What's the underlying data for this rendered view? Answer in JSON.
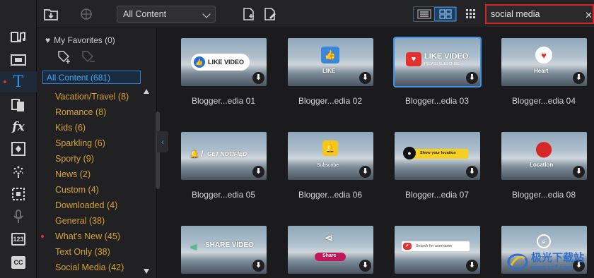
{
  "toolbar": {
    "filter_value": "All Content",
    "search_value": "social media"
  },
  "panel": {
    "favorites_label": "My Favorites (0)",
    "all_content_label": "All Content (681)",
    "categories": [
      {
        "label": "Vacation/Travel  (8)",
        "new": false
      },
      {
        "label": "Romance  (8)",
        "new": false
      },
      {
        "label": "Kids  (6)",
        "new": false
      },
      {
        "label": "Sparkling  (6)",
        "new": false
      },
      {
        "label": "Sporty  (9)",
        "new": false
      },
      {
        "label": "News  (2)",
        "new": false
      },
      {
        "label": "Custom  (4)",
        "new": false
      },
      {
        "label": "Downloaded  (4)",
        "new": false
      },
      {
        "label": "General  (38)",
        "new": false
      },
      {
        "label": "What's New  (45)",
        "new": true
      },
      {
        "label": "Text Only  (38)",
        "new": false
      },
      {
        "label": "Social Media  (42)",
        "new": false
      }
    ]
  },
  "grid": {
    "items": [
      {
        "caption": "Blogger...edia 01",
        "thumb_text": "LIKE VIDEO"
      },
      {
        "caption": "Blogger...edia 02",
        "thumb_text": "LIKE"
      },
      {
        "caption": "Blogger...edia 03",
        "thumb_text": "LIKE VIDEO",
        "thumb_sub": "PLEASE SUBSCRIBE",
        "selected": true
      },
      {
        "caption": "Blogger...edia 04",
        "thumb_text": "Heart"
      },
      {
        "caption": "Blogger...edia 05",
        "thumb_text": "GET NOTIFIED"
      },
      {
        "caption": "Blogger...edia 06",
        "thumb_text": "Subscribe"
      },
      {
        "caption": "Blogger...edia 07",
        "thumb_text": "Show your location"
      },
      {
        "caption": "Blogger...edia 08",
        "thumb_text": "Location"
      },
      {
        "caption": "",
        "thumb_text": "SHARE VIDEO"
      },
      {
        "caption": "",
        "thumb_text": "Share"
      },
      {
        "caption": "",
        "thumb_text": "Search for username"
      },
      {
        "caption": "",
        "thumb_text": "Search"
      }
    ]
  },
  "watermark": {
    "title": "极光下载站",
    "url": "www.xz7.com"
  },
  "colors": {
    "accent_blue": "#2f8fe6",
    "category_text": "#d6a23a",
    "search_border": "#d92323",
    "new_dot": "#e0303a"
  }
}
